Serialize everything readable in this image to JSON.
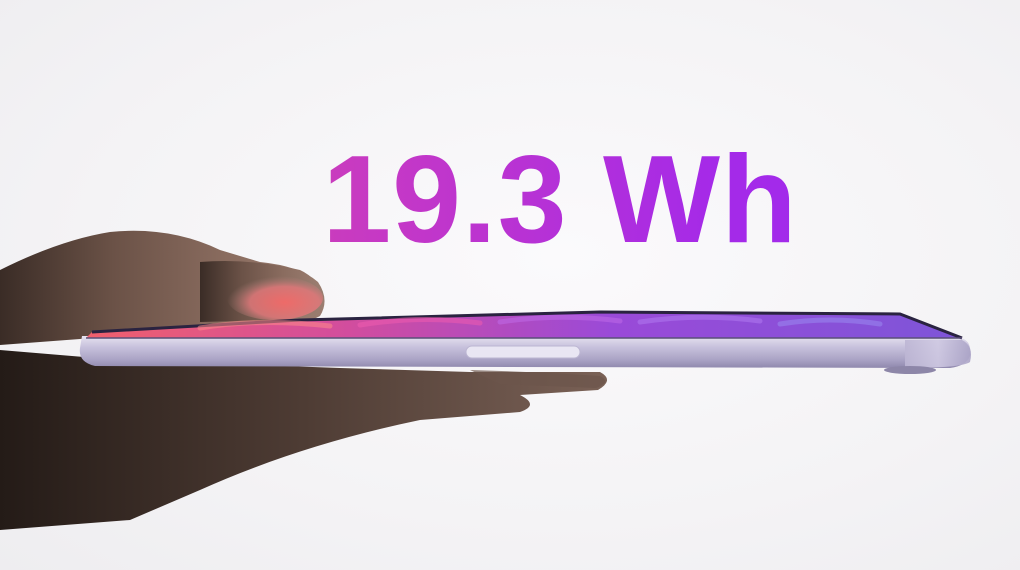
{
  "headline": {
    "text": "19.3 Wh"
  },
  "colors": {
    "headline_start": "#e0508f",
    "headline_mid": "#c538c6",
    "headline_end": "#9b2af0",
    "tablet_body": "#b9b4cf",
    "background": "#f5f4f6"
  }
}
